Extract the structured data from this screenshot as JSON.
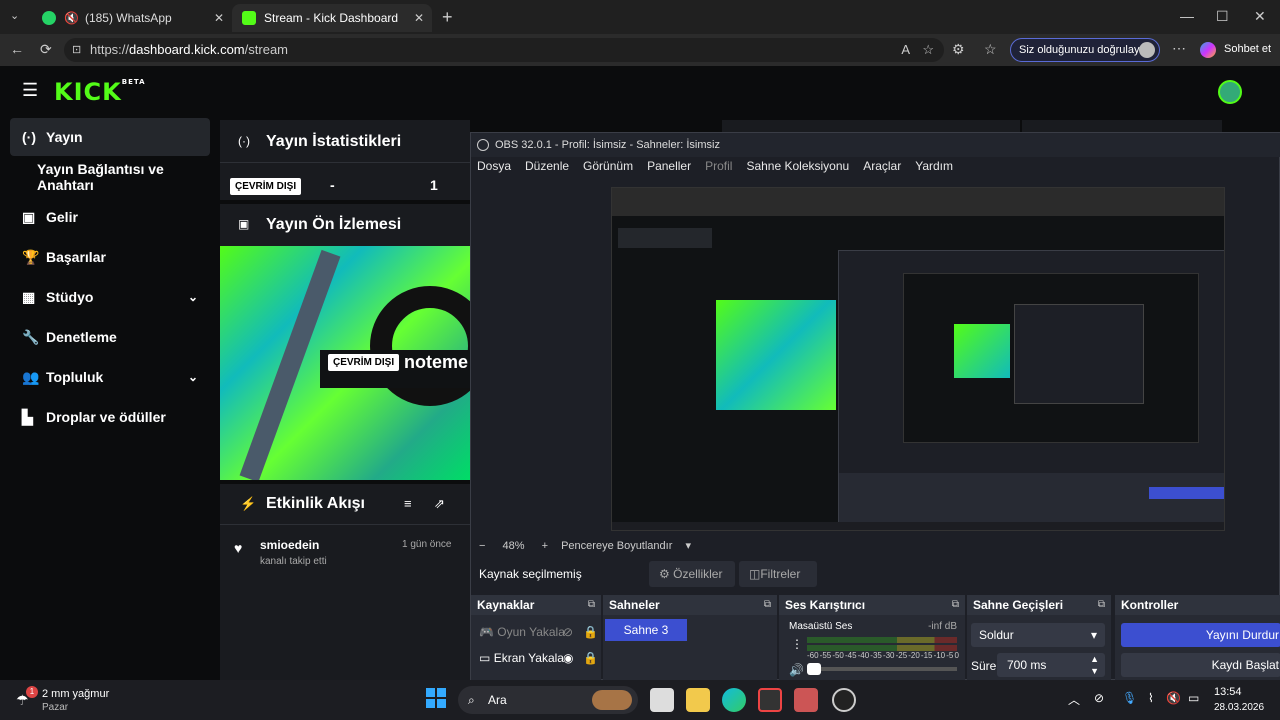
{
  "browser": {
    "tabs": [
      {
        "label": "(185) WhatsApp",
        "icon": "whatsapp-icon"
      },
      {
        "label": "Stream - Kick Dashboard",
        "icon": "kick-icon"
      }
    ],
    "url_prefix": "https://",
    "url_domain": "dashboard.kick.com",
    "url_path": "/stream",
    "verify_label": "Siz olduğunuzu doğrulayın",
    "copilot_label": "Sohbet et"
  },
  "kick": {
    "logo": "KICK",
    "logo_sup": "BETA",
    "sidebar": [
      {
        "label": "Yayın",
        "icon": "broadcast-icon"
      },
      {
        "label": "Yayın Bağlantısı ve Anahtarı",
        "icon": ""
      },
      {
        "label": "Gelir",
        "icon": "dollar-icon"
      },
      {
        "label": "Başarılar",
        "icon": "trophy-icon"
      },
      {
        "label": "Stüdyo",
        "icon": "film-icon"
      },
      {
        "label": "Denetleme",
        "icon": "wrench-icon"
      },
      {
        "label": "Topluluk",
        "icon": "people-icon"
      },
      {
        "label": "Droplar ve ödüller",
        "icon": "gift-icon"
      }
    ],
    "stats": {
      "title": "Yayın İstatistikleri",
      "status": "ÇEVRİM DIŞI",
      "value1": "-",
      "value2": "1"
    },
    "preview": {
      "title": "Yayın Ön İzlemesi",
      "status": "ÇEVRİM DIŞI",
      "name": "noteme"
    },
    "activity": {
      "title": "Etkinlik Akışı",
      "user": "smioedein",
      "action": "kanalı takip etti",
      "time": "1 gün önce"
    }
  },
  "obs": {
    "title": "OBS 32.0.1 - Profil: İsimsiz - Sahneler: İsimsiz",
    "menu": [
      "Dosya",
      "Düzenle",
      "Görünüm",
      "Paneller",
      "Profil",
      "Sahne Koleksiyonu",
      "Araçlar",
      "Yardım"
    ],
    "zoom": "48%",
    "fit_label": "Pencereye Boyutlandır",
    "no_source": "Kaynak seçilmemiş",
    "properties": "Özellikler",
    "filters": "Filtreler",
    "docks": {
      "sources": {
        "title": "Kaynaklar",
        "items": [
          "Oyun Yakala",
          "Ekran Yakala"
        ]
      },
      "scenes": {
        "title": "Sahneler",
        "items": [
          "Sahne 3"
        ]
      },
      "mixer": {
        "title": "Ses Karıştırıcı",
        "channel": "Masaüstü Ses",
        "level": "-inf dB",
        "ticks": [
          "-60",
          "-55",
          "-50",
          "-45",
          "-40",
          "-35",
          "-30",
          "-25",
          "-20",
          "-15",
          "-10",
          "-5",
          "0"
        ]
      },
      "transitions": {
        "title": "Sahne Geçişleri",
        "type": "Soldur",
        "duration_label": "Süre",
        "duration": "700 ms"
      },
      "controls": {
        "title": "Kontroller",
        "stop_stream": "Yayını Durdur",
        "record": "Kaydı Başlat"
      }
    }
  },
  "taskbar": {
    "weather": "2 mm yağmur",
    "weather_sub": "Pazar",
    "weather_badge": "1",
    "search": "Ara",
    "time": "13:54",
    "date": "28.03.2026"
  }
}
